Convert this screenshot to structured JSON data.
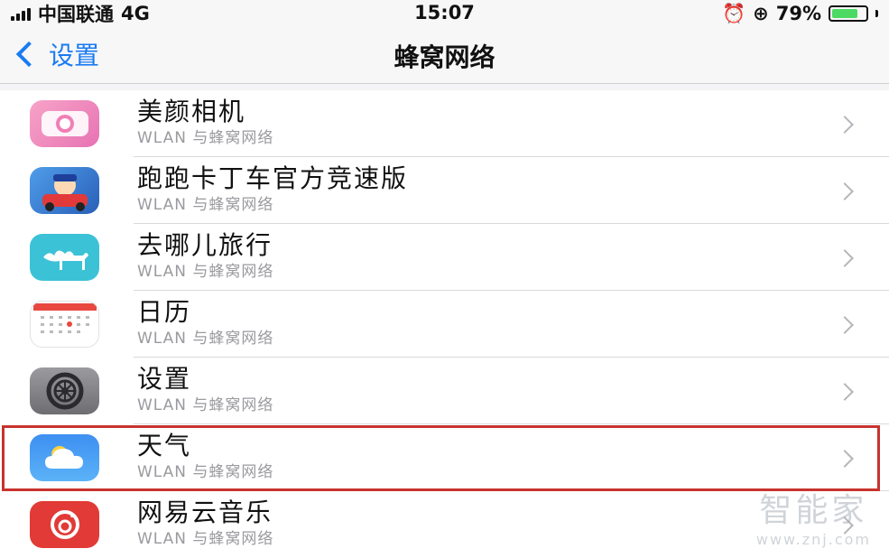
{
  "status_bar": {
    "carrier": "中国联通",
    "network": "4G",
    "time": "15:07",
    "battery_percent": "79%",
    "battery_level": 0.79
  },
  "nav": {
    "back_label": "设置",
    "title": "蜂窝网络"
  },
  "apps": [
    {
      "name": "美颜相机",
      "subtitle": "WLAN 与蜂窝网络",
      "icon": "camera-beauty-icon"
    },
    {
      "name": "跑跑卡丁车官方竞速版",
      "subtitle": "WLAN 与蜂窝网络",
      "icon": "kart-game-icon"
    },
    {
      "name": "去哪儿旅行",
      "subtitle": "WLAN 与蜂窝网络",
      "icon": "camel-icon"
    },
    {
      "name": "日历",
      "subtitle": "WLAN 与蜂窝网络",
      "icon": "calendar-icon"
    },
    {
      "name": "设置",
      "subtitle": "WLAN 与蜂窝网络",
      "icon": "gear-icon"
    },
    {
      "name": "天气",
      "subtitle": "WLAN 与蜂窝网络",
      "icon": "weather-icon"
    },
    {
      "name": "网易云音乐",
      "subtitle": "WLAN 与蜂窝网络",
      "icon": "music-icon"
    }
  ],
  "watermark": {
    "title": "智能家",
    "url": "www.znj.com"
  },
  "colors": {
    "accent": "#1a7bf2",
    "highlight": "#c8332e"
  }
}
